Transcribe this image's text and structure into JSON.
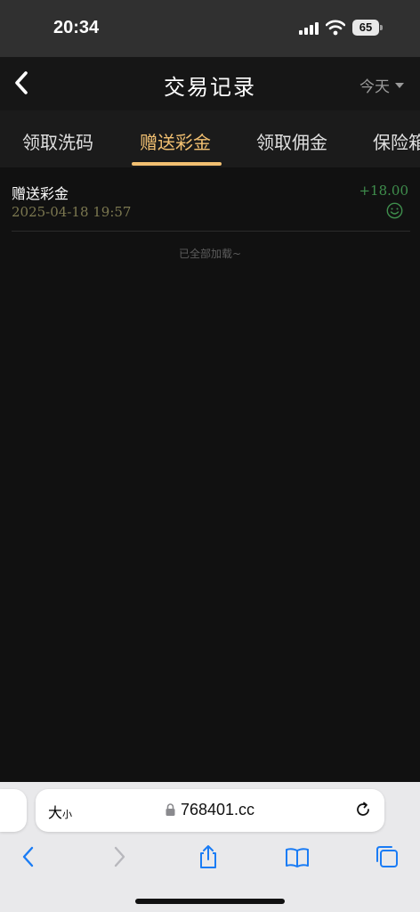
{
  "status_bar": {
    "time": "20:34",
    "battery": "65",
    "icons": [
      "signal-icon",
      "wifi-icon",
      "battery-icon"
    ]
  },
  "header": {
    "title": "交易记录",
    "period_label": "今天",
    "back_icon": "chevron-left-icon"
  },
  "tabs": [
    {
      "label": "领取洗码",
      "active": false
    },
    {
      "label": "赠送彩金",
      "active": true
    },
    {
      "label": "领取佣金",
      "active": false
    },
    {
      "label": "保险箱",
      "active": false
    }
  ],
  "records": [
    {
      "title": "赠送彩金",
      "datetime": "2025-04-18 19:57",
      "amount": "+18.00",
      "status_icon": "smile-icon"
    }
  ],
  "list_end_text": "已全部加载~",
  "browser": {
    "text_size_label": "大",
    "text_size_label_small": "小",
    "url": "768401.cc",
    "toolbar": [
      "back-icon",
      "forward-icon",
      "share-icon",
      "bookmarks-icon",
      "tabs-icon"
    ]
  },
  "colors": {
    "accent": "#f2c071",
    "amount_positive": "#3f8f4d",
    "date_text": "#7c7850",
    "background": "#111111"
  }
}
